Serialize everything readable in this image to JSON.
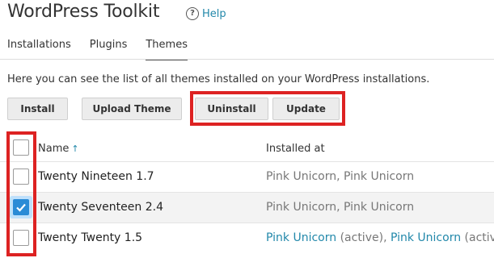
{
  "header": {
    "title": "WordPress Toolkit",
    "help_label": "Help",
    "help_icon": "help-circle-icon"
  },
  "tabs": [
    {
      "label": "Installations",
      "active": false
    },
    {
      "label": "Plugins",
      "active": false
    },
    {
      "label": "Themes",
      "active": true
    }
  ],
  "description": "Here you can see the list of all themes installed on your WordPress installations.",
  "toolbar": {
    "install_label": "Install",
    "upload_label": "Upload Theme",
    "uninstall_label": "Uninstall",
    "update_label": "Update"
  },
  "table": {
    "columns": {
      "name": "Name",
      "installed_at": "Installed at"
    },
    "sort_icon": "arrow-up-icon",
    "rows": [
      {
        "name": "Twenty Nineteen 1.7",
        "selected": false,
        "installed_at": "Pink Unicorn, Pink Unicorn"
      },
      {
        "name": "Twenty Seventeen 2.4",
        "selected": true,
        "installed_at": "Pink Unicorn, Pink Unicorn"
      },
      {
        "name": "Twenty Twenty 1.5",
        "selected": false,
        "installed": [
          {
            "site": "Pink Unicorn",
            "status": "(active)"
          },
          {
            "site": "Pink Unicorn",
            "status": "(active)"
          }
        ]
      }
    ]
  },
  "colors": {
    "accent": "#2a8bd6",
    "link": "#2288aa",
    "highlight": "#dd2222"
  }
}
